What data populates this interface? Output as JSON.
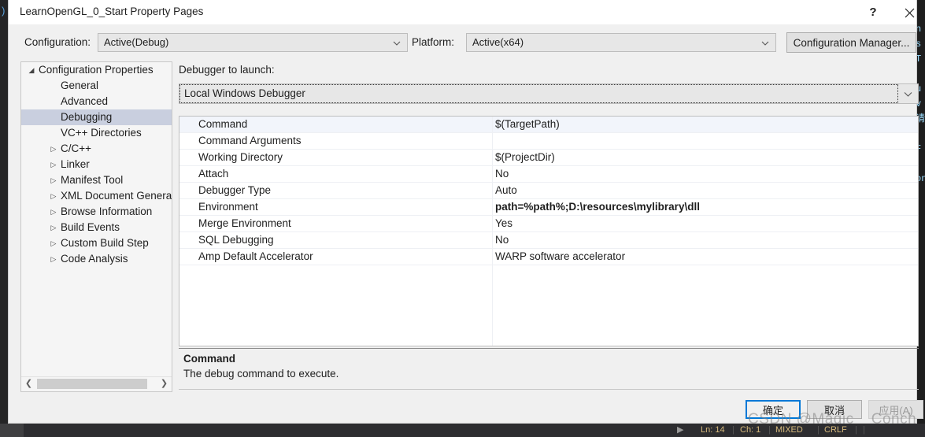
{
  "window": {
    "title": "LearnOpenGL_0_Start Property Pages",
    "help_button": "?",
    "close_button": "close-icon"
  },
  "config_bar": {
    "configuration_label": "Configuration:",
    "configuration_value": "Active(Debug)",
    "platform_label": "Platform:",
    "platform_value": "Active(x64)",
    "configuration_manager_button": "Configuration Manager..."
  },
  "tree": {
    "items": [
      {
        "label": "Configuration Properties",
        "level": 0,
        "glyph": "◢",
        "expanded": true,
        "selected": false
      },
      {
        "label": "General",
        "level": 1,
        "glyph": "",
        "expanded": false,
        "selected": false
      },
      {
        "label": "Advanced",
        "level": 1,
        "glyph": "",
        "expanded": false,
        "selected": false
      },
      {
        "label": "Debugging",
        "level": 1,
        "glyph": "",
        "expanded": false,
        "selected": true
      },
      {
        "label": "VC++ Directories",
        "level": 1,
        "glyph": "",
        "expanded": false,
        "selected": false
      },
      {
        "label": "C/C++",
        "level": 1,
        "glyph": "▷",
        "expanded": false,
        "selected": false
      },
      {
        "label": "Linker",
        "level": 1,
        "glyph": "▷",
        "expanded": false,
        "selected": false
      },
      {
        "label": "Manifest Tool",
        "level": 1,
        "glyph": "▷",
        "expanded": false,
        "selected": false
      },
      {
        "label": "XML Document Generat",
        "level": 1,
        "glyph": "▷",
        "expanded": false,
        "selected": false
      },
      {
        "label": "Browse Information",
        "level": 1,
        "glyph": "▷",
        "expanded": false,
        "selected": false
      },
      {
        "label": "Build Events",
        "level": 1,
        "glyph": "▷",
        "expanded": false,
        "selected": false
      },
      {
        "label": "Custom Build Step",
        "level": 1,
        "glyph": "▷",
        "expanded": false,
        "selected": false
      },
      {
        "label": "Code Analysis",
        "level": 1,
        "glyph": "▷",
        "expanded": false,
        "selected": false
      }
    ],
    "hscroll_left": "❮",
    "hscroll_right": "❯"
  },
  "main": {
    "debugger_to_launch_label": "Debugger to launch:",
    "debugger_selected": "Local Windows Debugger",
    "properties": [
      {
        "name": "Command",
        "value": "$(TargetPath)",
        "bold": false,
        "selected": true
      },
      {
        "name": "Command Arguments",
        "value": "",
        "bold": false,
        "selected": false
      },
      {
        "name": "Working Directory",
        "value": "$(ProjectDir)",
        "bold": false,
        "selected": false
      },
      {
        "name": "Attach",
        "value": "No",
        "bold": false,
        "selected": false
      },
      {
        "name": "Debugger Type",
        "value": "Auto",
        "bold": false,
        "selected": false
      },
      {
        "name": "Environment",
        "value": "path=%path%;D:\\resources\\mylibrary\\dll",
        "bold": true,
        "selected": false
      },
      {
        "name": "Merge Environment",
        "value": "Yes",
        "bold": false,
        "selected": false
      },
      {
        "name": "SQL Debugging",
        "value": "No",
        "bold": false,
        "selected": false
      },
      {
        "name": "Amp Default Accelerator",
        "value": "WARP software accelerator",
        "bold": false,
        "selected": false
      }
    ],
    "description_title": "Command",
    "description_text": "The debug command to execute."
  },
  "footer": {
    "ok_button": "确定",
    "cancel_button": "取消",
    "apply_button": "应用(A)"
  },
  "status_bar": {
    "run_glyph": "▶",
    "line": "Ln: 14",
    "char": "Ch: 1",
    "encoding": "MIXED",
    "eol": "CRLF",
    "sep": "|"
  },
  "watermark": "CSDN @Magic__Conch",
  "backdrop": {
    "left_glyph": ")",
    "code_column": "n\ns\nT\n\nu\nv\n请\n\nF\n\non"
  },
  "colors": {
    "accent": "#0078d7",
    "dialog_bg": "#f0f0f0",
    "tree_selection": "#c9cfdf",
    "grid_selection": "#f2f5fb",
    "editor_bg": "#1e1e1e",
    "status_text": "#d7ba7d"
  }
}
